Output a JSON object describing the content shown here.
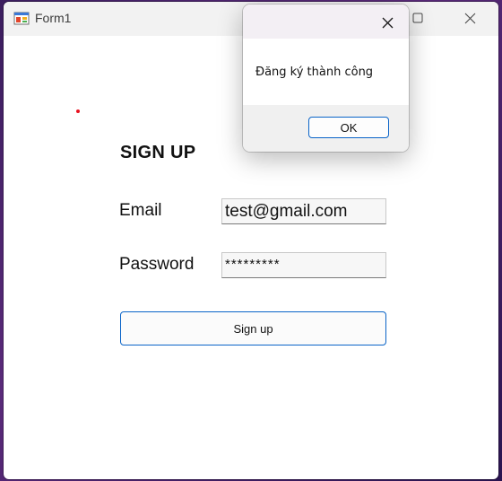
{
  "window": {
    "title": "Form1",
    "icon": "winforms-app-icon"
  },
  "form": {
    "heading": "SIGN UP",
    "email_label": "Email",
    "email_value": "test@gmail.com",
    "password_label": "Password",
    "password_value": "*********",
    "signup_button_label": "Sign up"
  },
  "dialog": {
    "message": "Đăng ký thành công",
    "ok_label": "OK"
  },
  "colors": {
    "accent": "#0a64c8",
    "dot": "#e8111f"
  }
}
